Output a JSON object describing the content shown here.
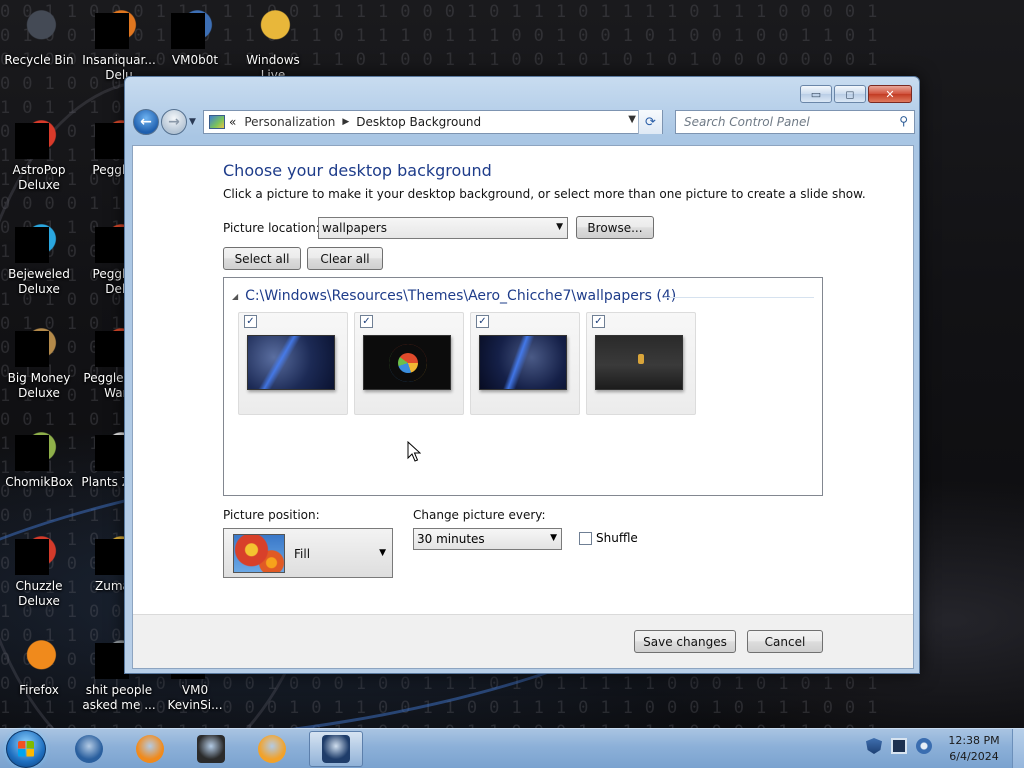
{
  "desktop": {
    "icons": [
      {
        "label": "Recycle Bin",
        "icon": "recycle-bin-icon",
        "color": "#444a55"
      },
      {
        "label": "Insaniquar... Delu",
        "icon": "insaniquarium-icon",
        "color": "#e0761f"
      },
      {
        "label": "VM0b0t",
        "icon": "vm0b0t-icon",
        "color": "#3d6fb5"
      },
      {
        "label": "Windows Live",
        "icon": "windows-live-icon",
        "color": "#e8b73a"
      },
      {
        "label": "AstroPop Deluxe",
        "icon": "astropop-icon",
        "color": "#d93a2a"
      },
      {
        "label": "Peggle D",
        "icon": "peggle-icon",
        "color": "#e04a2b"
      },
      {
        "label": "Bejeweled Deluxe",
        "icon": "bejeweled-icon",
        "color": "#2aa7e0"
      },
      {
        "label": "Peggle N Delu",
        "icon": "peggle-nights-icon",
        "color": "#e04a2b"
      },
      {
        "label": "Big Money Deluxe",
        "icon": "big-money-icon",
        "color": "#b48a4a"
      },
      {
        "label": "Peggle W of Warc",
        "icon": "peggle-wow-icon",
        "color": "#e04a2b"
      },
      {
        "label": "ChomikBox",
        "icon": "chomikbox-icon",
        "color": "#8fb04a"
      },
      {
        "label": "Plants Zomb",
        "icon": "plants-zombies-icon",
        "color": "#f2f2f2"
      },
      {
        "label": "Chuzzle Deluxe",
        "icon": "chuzzle-icon",
        "color": "#d43a2a"
      },
      {
        "label": "Zuma D",
        "icon": "zuma-icon",
        "color": "#e8b73a"
      },
      {
        "label": "Firefox",
        "icon": "firefox-icon",
        "color": "#f08a1c"
      },
      {
        "label": "shit people asked me ...",
        "icon": "text-file-icon",
        "color": "#9aa2a8"
      },
      {
        "label": "VM0 KevinSi...",
        "icon": "vm0-kevinsi-icon",
        "color": "#3a3a3a"
      }
    ]
  },
  "window": {
    "buttons": {
      "minimize": "▭",
      "maximize": "◻",
      "close": "✕"
    },
    "address": {
      "chevron": "«",
      "crumbs": [
        "Personalization",
        "Desktop Background"
      ],
      "separator": "▶"
    },
    "search": {
      "placeholder": "Search Control Panel"
    },
    "heading": "Choose your desktop background",
    "subtext": "Click a picture to make it your desktop background, or select more than one picture to create a slide show.",
    "picture_location": {
      "label": "Picture location:",
      "value": "wallpapers"
    },
    "browse_label": "Browse...",
    "select_all_label": "Select all",
    "clear_all_label": "Clear all",
    "gallery": {
      "header": "C:\\Windows\\Resources\\Themes\\Aero_Chicche7\\wallpapers (4)",
      "items": [
        {
          "checked": true,
          "style": "pic-a"
        },
        {
          "checked": true,
          "style": "pic-b"
        },
        {
          "checked": true,
          "style": "pic-c"
        },
        {
          "checked": true,
          "style": "pic-d"
        }
      ]
    },
    "picture_position": {
      "label": "Picture position:",
      "value": "Fill"
    },
    "change_picture": {
      "label": "Change picture every:",
      "value": "30 minutes"
    },
    "shuffle_label": "Shuffle",
    "save_label": "Save changes",
    "cancel_label": "Cancel"
  },
  "taskbar": {
    "apps": [
      {
        "name": "tb-app-globe",
        "icon": "globe-icon",
        "color": "#2a5f9e"
      },
      {
        "name": "tb-app-firefox",
        "icon": "firefox-icon",
        "color": "#f08a1c"
      },
      {
        "name": "tb-app-media",
        "icon": "media-center-icon",
        "color": "#2b2b2b"
      },
      {
        "name": "tb-app-player",
        "icon": "media-player-icon",
        "color": "#f2a22a"
      },
      {
        "name": "tb-app-personalization",
        "icon": "personalization-icon",
        "color": "#1f3d6a",
        "active": true
      }
    ],
    "clock": {
      "time": "12:38 PM",
      "date": "6/4/2024"
    }
  }
}
